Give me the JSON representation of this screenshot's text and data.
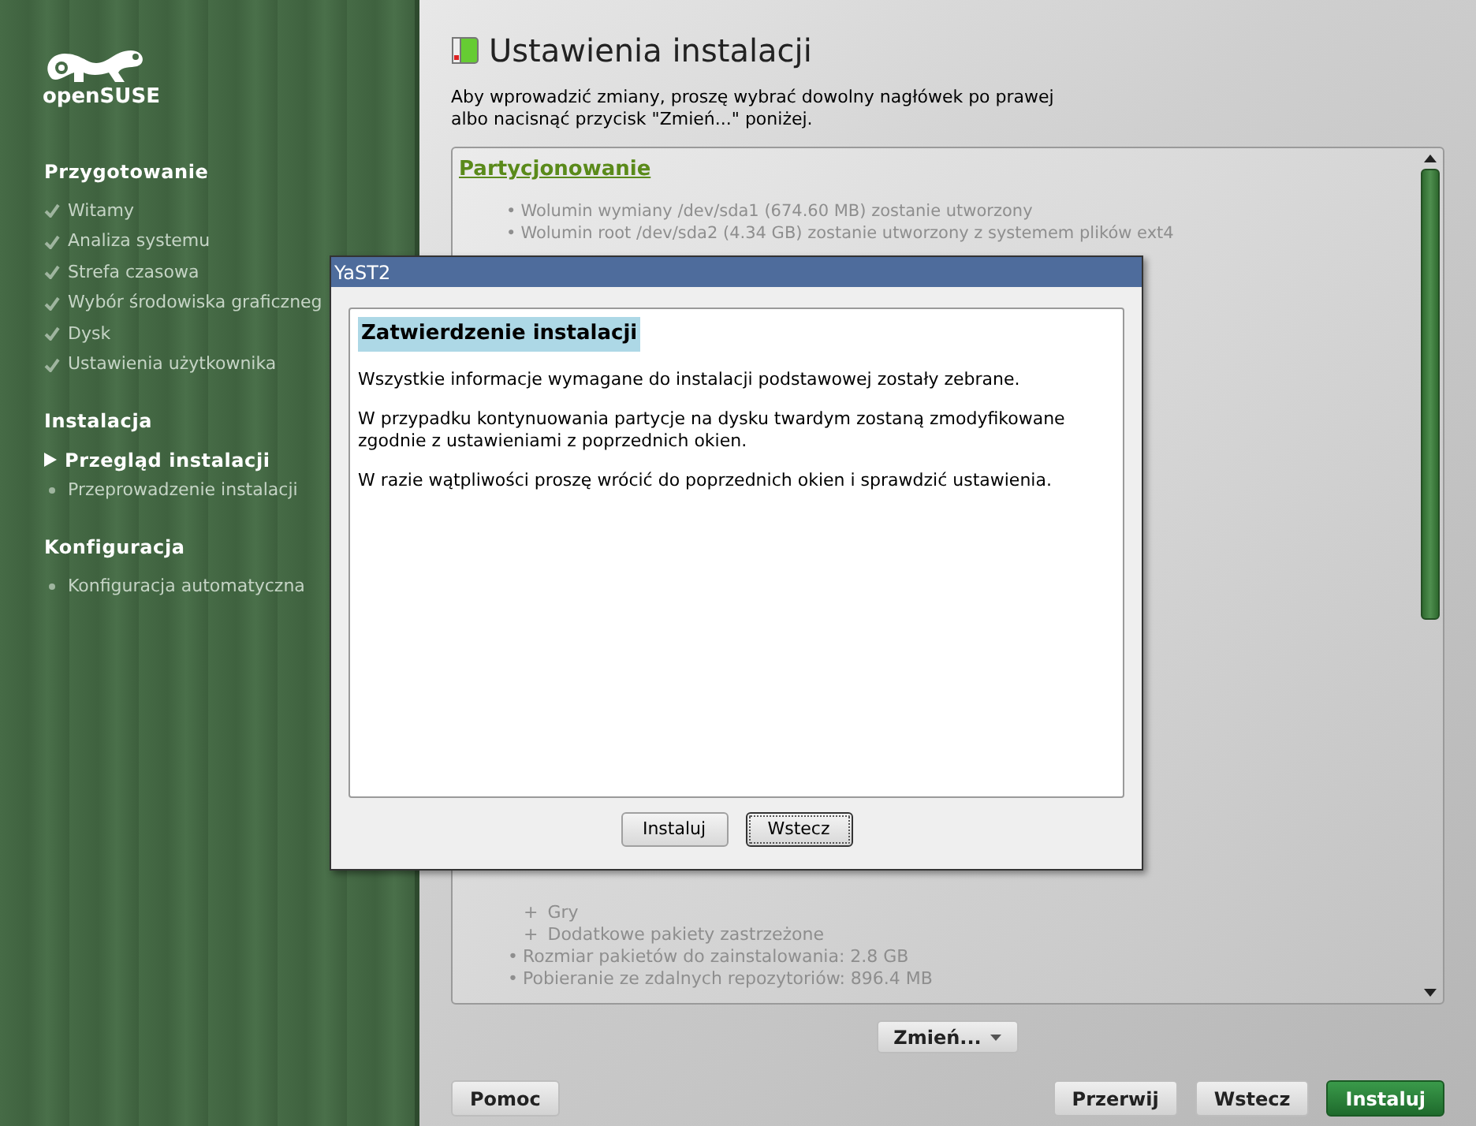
{
  "sidebar": {
    "logo_text": "openSUSE",
    "sections": [
      {
        "title": "Przygotowanie",
        "items": [
          {
            "label": "Witamy",
            "kind": "done"
          },
          {
            "label": "Analiza systemu",
            "kind": "done"
          },
          {
            "label": "Strefa czasowa",
            "kind": "done"
          },
          {
            "label": "Wybór środowiska graficzneg",
            "kind": "done"
          },
          {
            "label": "Dysk",
            "kind": "done"
          },
          {
            "label": "Ustawienia użytkownika",
            "kind": "done"
          }
        ]
      },
      {
        "title": "Instalacja",
        "items": [
          {
            "label": "Przegląd instalacji",
            "kind": "current"
          },
          {
            "label": "Przeprowadzenie instalacji",
            "kind": "todo"
          }
        ]
      },
      {
        "title": "Konfiguracja",
        "items": [
          {
            "label": "Konfiguracja automatyczna",
            "kind": "todo"
          }
        ]
      }
    ]
  },
  "main": {
    "title": "Ustawienia instalacji",
    "intro": [
      "Aby wprowadzić zmiany, proszę wybrać dowolny nagłówek po prawej",
      "albo nacisnąć przycisk \"Zmień...\" poniżej."
    ],
    "summary_top": {
      "heading": "Partycjonowanie",
      "bullets": [
        {
          "marker": "•",
          "text": "Wolumin wymiany /dev/sda1 (674.60 MB) zostanie utworzony"
        },
        {
          "marker": "•",
          "text": "Wolumin root /dev/sda2 (4.34 GB) zostanie utworzony z systemem plików ext4"
        }
      ]
    },
    "summary_bottom": [
      {
        "kind": "sub",
        "marker": "+",
        "text": "Gry"
      },
      {
        "kind": "sub",
        "marker": "+",
        "text": "Dodatkowe pakiety zastrzeżone"
      },
      {
        "kind": "bullet",
        "marker": "•",
        "text": "Rozmiar pakietów do zainstalowania: 2.8 GB"
      },
      {
        "kind": "bullet",
        "marker": "•",
        "text": "Pobieranie ze zdalnych repozytoriów: 896.4 MB"
      }
    ],
    "change_button": "Zmień...",
    "buttons": [
      {
        "label": "Pomoc",
        "kind": "plain"
      },
      {
        "label": "Przerwij",
        "kind": "plain"
      },
      {
        "label": "Wstecz",
        "kind": "plain"
      },
      {
        "label": "Instaluj",
        "kind": "primary"
      }
    ]
  },
  "dialog": {
    "title": "YaST2",
    "heading": "Zatwierdzenie instalacji",
    "paragraphs": [
      "Wszystkie informacje wymagane do instalacji podstawowej zostały zebrane.",
      "W przypadku kontynuowania partycje na dysku twardym zostaną zmodyfikowane zgodnie z ustawieniami z poprzednich okien.",
      "W razie wątpliwości proszę wrócić do poprzednich okien i sprawdzić ustawienia."
    ],
    "buttons": [
      {
        "label": "Instaluj",
        "focused": false
      },
      {
        "label": "Wstecz",
        "focused": true
      }
    ]
  }
}
